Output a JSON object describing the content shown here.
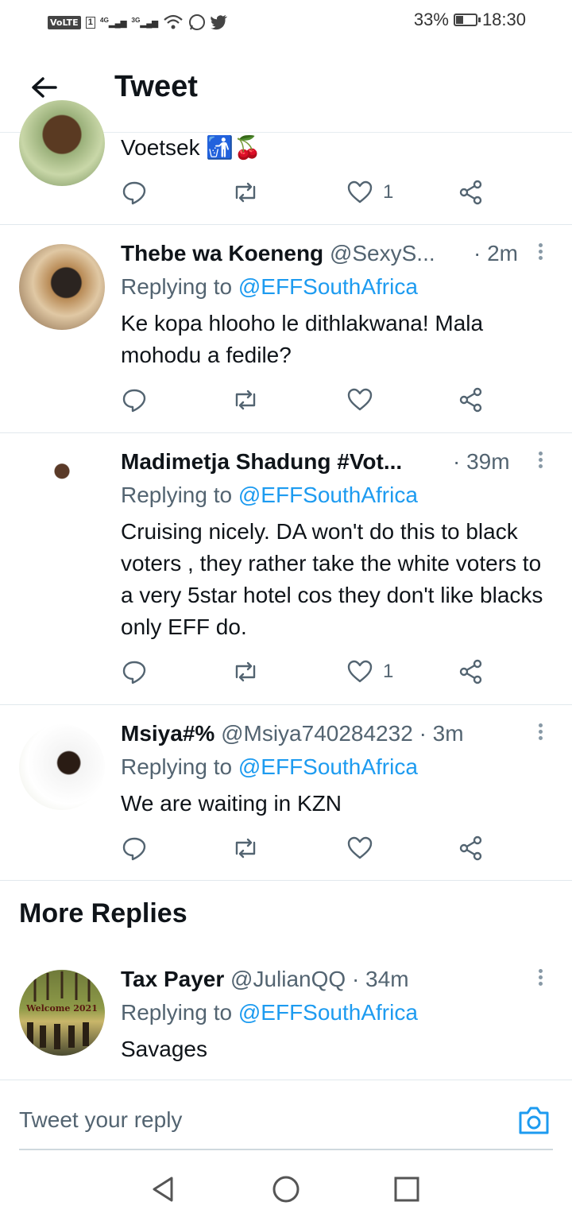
{
  "status_bar": {
    "volte": "VoLTE",
    "sim": "1",
    "net1": "4G",
    "net2": "3G",
    "battery": "33%",
    "battery_level": 0.33,
    "time": "18:30"
  },
  "header": {
    "title": "Tweet"
  },
  "tweets": [
    {
      "text": "Voetsek 🚮🍒",
      "likes": "1"
    },
    {
      "name": "Thebe wa Koeneng",
      "handle": "@SexyS...",
      "time": "· 2m",
      "replying_prefix": "Replying to",
      "replying_to": "@EFFSouthAfrica",
      "text": "Ke kopa hlooho le dithlakwana! Mala mohodu a fedile?",
      "likes": ""
    },
    {
      "name": "Madimetja Shadung #Vot...",
      "handle": "",
      "time": "· 39m",
      "replying_prefix": "Replying to",
      "replying_to": "@EFFSouthAfrica",
      "text": "Cruising nicely. DA won't do this to black voters , they rather take the white voters to a very 5star hotel cos they don't like blacks only EFF do.",
      "likes": "1"
    },
    {
      "name": "Msiya#%",
      "handle": "@Msiya740284232",
      "time": "· 3m",
      "replying_prefix": "Replying to",
      "replying_to": "@EFFSouthAfrica",
      "text": "We are waiting in KZN",
      "likes": ""
    }
  ],
  "more_replies": {
    "heading": "More Replies",
    "tweet": {
      "name": "Tax Payer",
      "handle": "@JulianQQ",
      "time": "· 34m",
      "replying_prefix": "Replying to",
      "replying_to": "@EFFSouthAfrica",
      "text": "Savages",
      "avatar_text": "Welcome 2021"
    }
  },
  "compose": {
    "placeholder": "Tweet your reply"
  },
  "icons": {
    "reply": "reply-icon",
    "retweet": "retweet-icon",
    "like": "heart-icon",
    "share": "share-icon",
    "back": "back-arrow-icon",
    "camera": "camera-icon"
  },
  "colors": {
    "accent": "#1d9bf0",
    "muted": "#536471",
    "text": "#0f1419"
  }
}
